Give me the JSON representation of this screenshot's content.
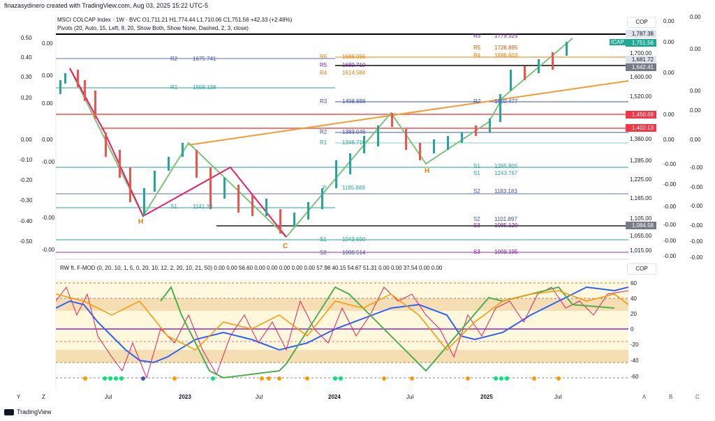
{
  "header": {
    "text": "finazasydinero created with TradingView.com, Aug 03, 2025 15:22 UTC-5"
  },
  "legend1": {
    "text": "MSCI COLCAP Index · 1W · BVC  O1,711.21  H1,774.44  L1,710.06  C1,751.56  +42.33 (+2.48%)"
  },
  "legend2": {
    "text": "Pivots (20, Auto, 15, Left, 8, 20, Show Both, Show None, Dashed, 2, 3, close)"
  },
  "osc_legend": {
    "text": "RW ft. F-MOD (0, 20, 10, 1, 5, 0, 20, 10, 12, 2, 20, 10, 21, 50)  0.00  0.00  56.60  0.00  0.00  0.00  0.00  0.00  57.98  40.15  54.67  51.31  0.00  0.00  37.54  0.00  0.00"
  },
  "cop_label": "COP",
  "cop_label2": "COP",
  "price_axis": [
    "1,700.00",
    "1,600.00",
    "1,520.00",
    "1,360.00",
    "1,285.00",
    "1,225.00",
    "1,165.00",
    "1,105.00",
    "1,055.00",
    "1,015.00"
  ],
  "price_tags": [
    {
      "text": "1,787.38",
      "bg": "#e0e3eb",
      "fg": "#131722"
    },
    {
      "text": "1,751.56",
      "bg": "#22ab94",
      "fg": "#ffffff"
    },
    {
      "text": "1,681.72",
      "bg": "#e0e3eb",
      "fg": "#131722"
    },
    {
      "text": "1,642.41",
      "bg": "#787b86",
      "fg": "#ffffff"
    },
    {
      "text": "1,450.69",
      "bg": "#f23645",
      "fg": "#ffffff"
    },
    {
      "text": "1,402.13",
      "bg": "#f23645",
      "fg": "#ffffff"
    },
    {
      "text": "1,084.58",
      "bg": "#787b86",
      "fg": "#ffffff"
    }
  ],
  "icap_tag": "ICAP",
  "right_col1": [
    "0.00",
    "0.00",
    "0.00",
    "0.00",
    "0.00",
    "-0.00",
    "-0.00",
    "-0.00",
    "-0.00",
    "-0.00",
    "-0.00"
  ],
  "right_col2": [
    "0.00",
    "0.00",
    "0.00",
    "0.00",
    "0.00",
    "-0.00",
    "-0.00",
    "-0.00",
    "-0.00",
    "-0.00",
    "-0.00"
  ],
  "left_axis": [
    "0.50",
    "0.40",
    "0.30",
    "0.20",
    "0.00",
    "-0.10",
    "-0.20",
    "-0.30",
    "-0.40",
    "-0.50"
  ],
  "left_axis2": [
    "0.00",
    "0.00",
    "0.00",
    "0.00",
    "0.00",
    "-0.00",
    "-0.00",
    "-0.00",
    "-0.00",
    "-0.00"
  ],
  "osc_axis": [
    "60",
    "40",
    "20",
    "0",
    "-20",
    "-40",
    "-60"
  ],
  "pivots": [
    {
      "t": "R2",
      "v": "1675.741"
    },
    {
      "t": "R1",
      "v": "1558.138"
    },
    {
      "t": "S1",
      "v": "1141.38"
    },
    {
      "t": "R6",
      "v": "1686.066"
    },
    {
      "t": "R5",
      "v": "1689.710"
    },
    {
      "t": "R4",
      "v": "1614.584"
    },
    {
      "t": "R3",
      "v": "1498.888"
    },
    {
      "t": "R2",
      "v": "1383.046"
    },
    {
      "t": "R1",
      "v": "1346.710"
    },
    {
      "t": "S1",
      "v": "1043.690"
    },
    {
      "t": "S2",
      "v": "1008.514"
    },
    {
      "t": "R3",
      "v": "1779.325"
    },
    {
      "t": "R5",
      "v": "1726.895"
    },
    {
      "t": "R4",
      "v": "1696.603"
    },
    {
      "t": "R2",
      "v": "1600.477"
    },
    {
      "t": "S1",
      "v": "1265.905"
    },
    {
      "t": "S1",
      "v": "1243.767"
    },
    {
      "t": "S2",
      "v": "1183.183"
    },
    {
      "t": "S2",
      "v": "1101.897"
    },
    {
      "t": "S3",
      "v": "1085.120"
    },
    {
      "t": "S3",
      "v": "1009.195"
    },
    {
      "t": "P",
      "v": "1195.889"
    }
  ],
  "pattern_labels": [
    "H",
    "C",
    "H"
  ],
  "xaxis": [
    {
      "t": "Y",
      "bold": false
    },
    {
      "t": "Z",
      "bold": false
    },
    {
      "t": "Jul",
      "bold": false
    },
    {
      "t": "2023",
      "bold": true
    },
    {
      "t": "Jul",
      "bold": false
    },
    {
      "t": "2024",
      "bold": true
    },
    {
      "t": "Jul",
      "bold": false
    },
    {
      "t": "2025",
      "bold": true
    },
    {
      "t": "Jul",
      "bold": false
    }
  ],
  "corner_btns": [
    "A",
    "B",
    "C"
  ],
  "footer": "TradingView"
}
